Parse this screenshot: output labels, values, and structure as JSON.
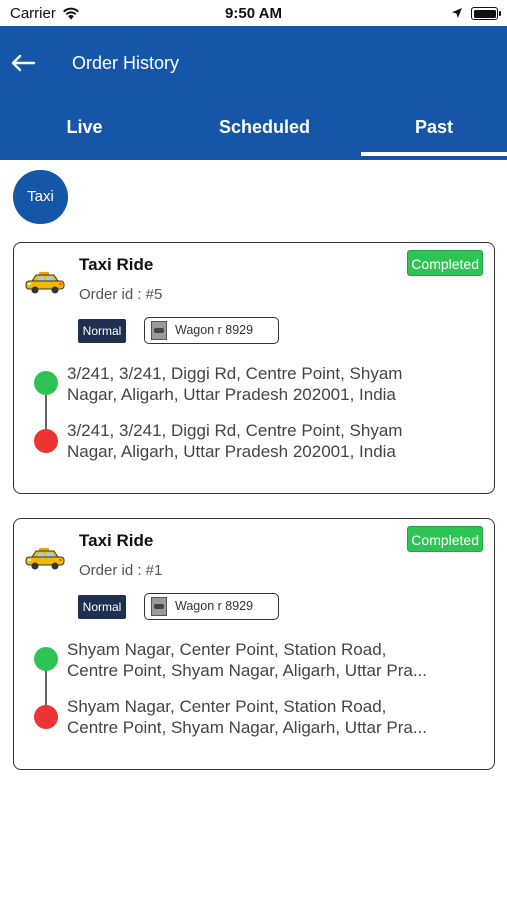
{
  "status_bar": {
    "carrier": "Carrier",
    "time": "9:50 AM",
    "icons": [
      "wifi-icon",
      "location-arrow-icon",
      "battery-icon"
    ]
  },
  "header": {
    "title": "Order History",
    "back_icon": "back-arrow-icon",
    "background": "#1556a8"
  },
  "tabs": [
    {
      "label": "Live",
      "active": false
    },
    {
      "label": "Scheduled",
      "active": false
    },
    {
      "label": "Past",
      "active": true
    }
  ],
  "filter": {
    "label": "Taxi"
  },
  "colors": {
    "primary": "#1556a8",
    "completed": "#2ec455",
    "pickup": "#2ec455",
    "drop": "#ee3333",
    "normal_badge": "#1f2f50"
  },
  "orders": [
    {
      "title": "Taxi Ride",
      "order_id": "Order id : #5",
      "status": "Completed",
      "type": "Normal",
      "vehicle": "Wagon r 8929",
      "pickup": [
        "3/241, 3/241, Diggi Rd, Centre Point, Shyam",
        "Nagar, Aligarh, Uttar Pradesh 202001, India"
      ],
      "drop": [
        "3/241, 3/241, Diggi Rd, Centre Point, Shyam",
        "Nagar, Aligarh, Uttar Pradesh 202001, India"
      ]
    },
    {
      "title": "Taxi Ride",
      "order_id": "Order id : #1",
      "status": "Completed",
      "type": "Normal",
      "vehicle": "Wagon r 8929",
      "pickup": [
        "Shyam Nagar, Center Point, Station Road,",
        "Centre Point, Shyam Nagar, Aligarh, Uttar Pra..."
      ],
      "drop": [
        "Shyam Nagar, Center Point, Station Road,",
        "Centre Point, Shyam Nagar, Aligarh, Uttar Pra..."
      ]
    }
  ]
}
